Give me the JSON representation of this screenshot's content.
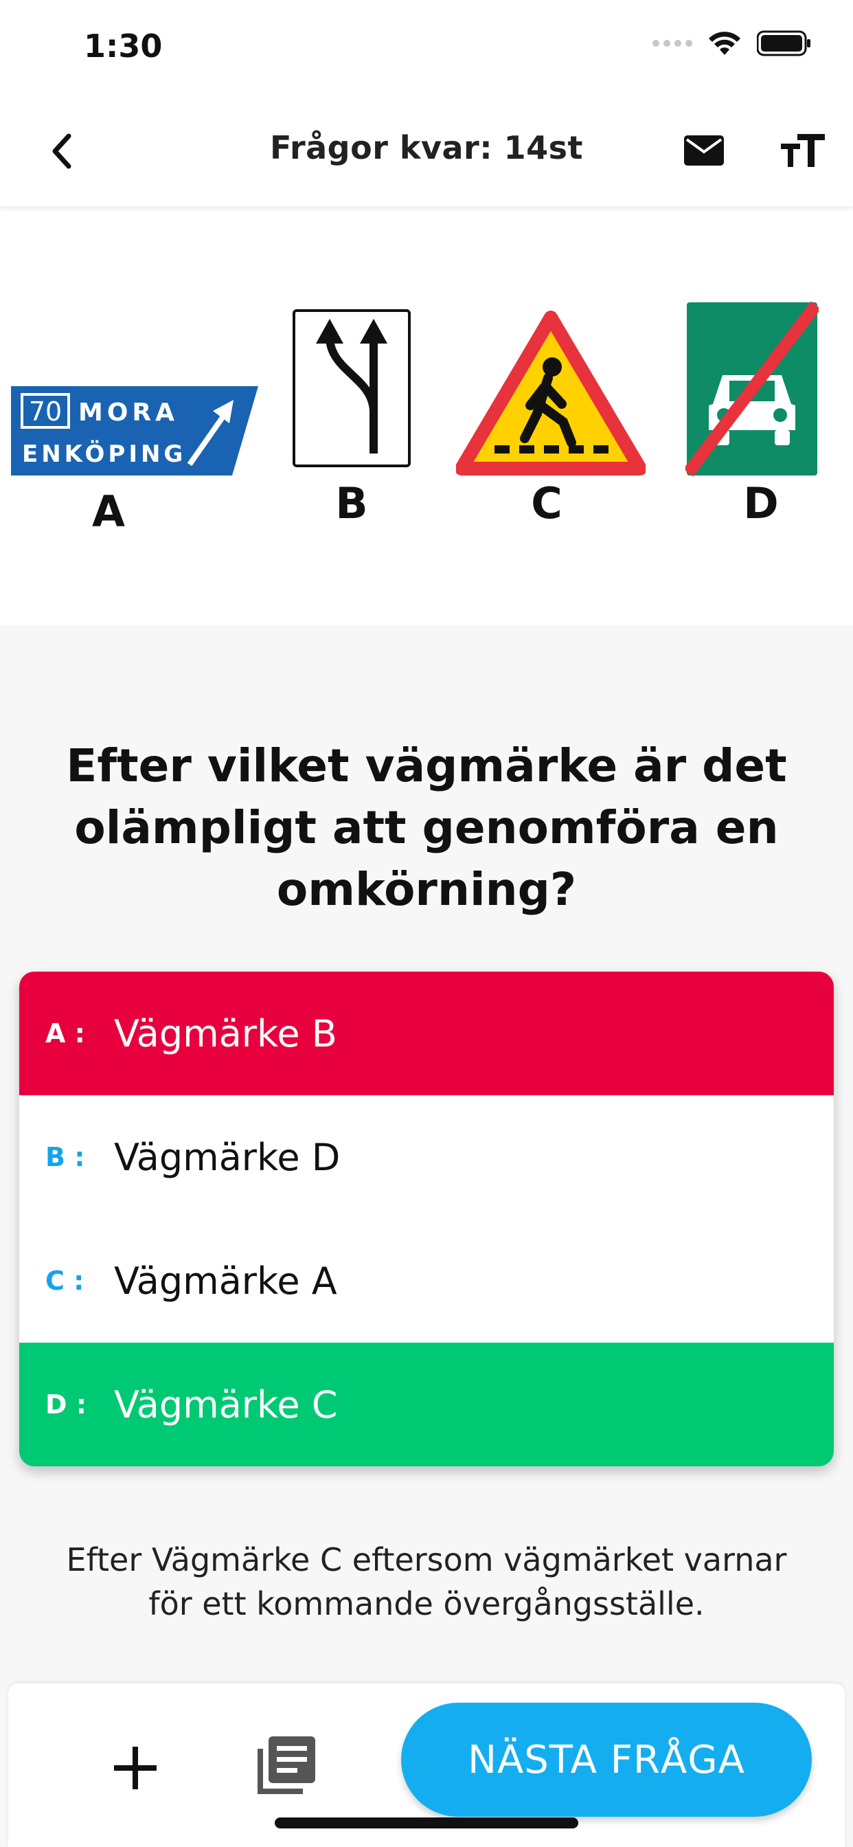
{
  "status": {
    "time": "1:30"
  },
  "nav": {
    "title": "Frågor kvar: 14st"
  },
  "signs": [
    {
      "label": "A",
      "text_line1": "MORA",
      "text_number": "70",
      "text_line2": "ENKÖPING"
    },
    {
      "label": "B"
    },
    {
      "label": "C"
    },
    {
      "label": "D"
    }
  ],
  "question": "Efter vilket vägmärke är det olämpligt att genomföra en omkörning?",
  "answers": [
    {
      "letter": "A :",
      "text": "Vägmärke B",
      "state": "wrong"
    },
    {
      "letter": "B :",
      "text": "Vägmärke D",
      "state": "neutral"
    },
    {
      "letter": "C :",
      "text": "Vägmärke A",
      "state": "neutral"
    },
    {
      "letter": "D :",
      "text": "Vägmärke C",
      "state": "correct"
    }
  ],
  "explanation": "Efter Vägmärke C eftersom vägmärket varnar för ett kommande övergångsställe.",
  "bottom": {
    "next_label": "NÄSTA FRÅGA"
  },
  "colors": {
    "wrong": "#e8003e",
    "correct": "#00c974",
    "accent": "#14aef0"
  }
}
